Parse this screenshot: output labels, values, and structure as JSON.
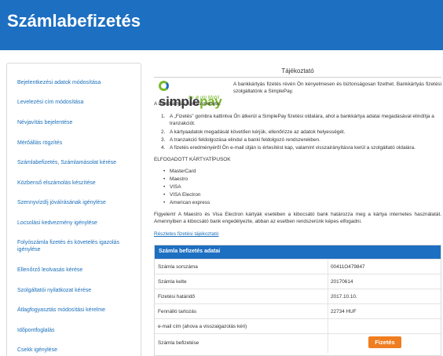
{
  "header": {
    "title": "Számlabefizetés"
  },
  "sidebar": {
    "items": [
      {
        "label": "Bejelentkezési adatok módosítása"
      },
      {
        "label": "Levelezési cím módosítása"
      },
      {
        "label": "Névjavítás bejelentése"
      },
      {
        "label": "Mérőállás rögzítés"
      },
      {
        "label": "Számlabefizetés, Számlamásolat kérése"
      },
      {
        "label": "Közbenső elszámolás készítése"
      },
      {
        "label": "Szennyvízdíj jóváírásának igénylése"
      },
      {
        "label": "Locsolási kedvezmény igénylése"
      },
      {
        "label": "Folyószámla fizetés és követelés igazolás igénylése"
      },
      {
        "label": "Ellenőrző leolvasás kérése"
      },
      {
        "label": "Szolgáltatói nyilatkozat kérése"
      },
      {
        "label": "Átlagfogyasztás módosítási kérelme"
      },
      {
        "label": "Időpontfoglalás"
      },
      {
        "label": "Csekk igénylése"
      }
    ]
  },
  "info": {
    "title": "Tájékoztató",
    "logo_simple": "simple",
    "logo_pay": "pay",
    "logo_by": "by ⊕ otp Mobil",
    "intro": "A bankkártyás fizetés révén Ön kényelmesen és biztonságosan fizethet. Bankkártyás fizetési szolgáltatónk a SimplePay.",
    "process_title": "A bankkártyás fizetés menete:",
    "steps": [
      "A „Fizetés” gombra kattintva Ön átkerül a SimplePay fizetési oldalára, ahol a bankkártya adatai megadásával elindítja a tranzakciót.",
      "A kártyaadatok megadását követően kérjük, ellenőrizze az adatok helyességét.",
      "A tranzakció feldolgozása elindul a banki feldolgozó rendszerekben.",
      "A fizetés eredményéről Ön e-mail útján is értesítést kap, valamint visszairányításra kerül a szolgáltató oldalára."
    ],
    "cards_title": "ELFOGADOTT KÁRTYATÍPUSOK",
    "cards": [
      "MasterCard",
      "Maestro",
      "VISA",
      "VISA Electron",
      "American express"
    ],
    "warning": "Figyelem! A Maestro és Visa Electron kártyák esetében a kibocsátó bank határozza meg a kártya internetes használatát. Amennyiben a kibocsátó bank engedélyezte, abban az esetben rendszerünk képes elfogadni.",
    "details_link": "Részletes fizetési tájékoztató"
  },
  "payment": {
    "header": "Számla befizetés adatai",
    "rows": [
      {
        "label": "Számla sorszáma",
        "value": "00411O479847"
      },
      {
        "label": "Számla kelte",
        "value": "20170614"
      },
      {
        "label": "Fizetési határidő",
        "value": "2017.10.10."
      },
      {
        "label": "Fennálló tartozás",
        "value": "22734 HUF"
      },
      {
        "label": "e-mail cím (ahova a visszaigazolás kéri)",
        "value": ""
      }
    ],
    "pay_row_label": "Számla befizetése",
    "pay_button": "Fizetés"
  },
  "colors": {
    "brand_blue": "#1d6fc1",
    "link_blue": "#1a6fba",
    "accent_orange": "#f07d1f",
    "simplepay_green": "#78b72c"
  }
}
